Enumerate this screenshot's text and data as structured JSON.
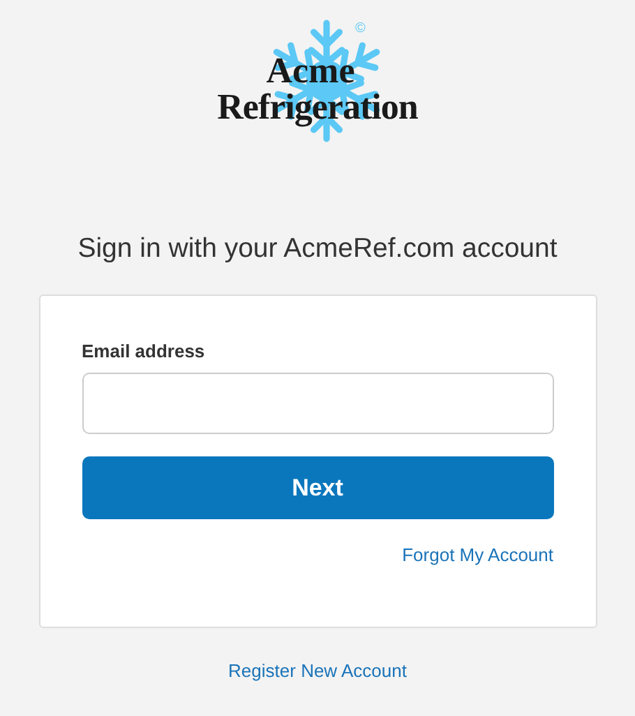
{
  "logo": {
    "line_1": "Acme",
    "line_2": "Refrigeration",
    "mark": "©"
  },
  "heading": "Sign in with your AcmeRef.com account",
  "form": {
    "email_label": "Email address",
    "next_button": "Next",
    "forgot_link": "Forgot My Account"
  },
  "register_link": "Register New Account"
}
